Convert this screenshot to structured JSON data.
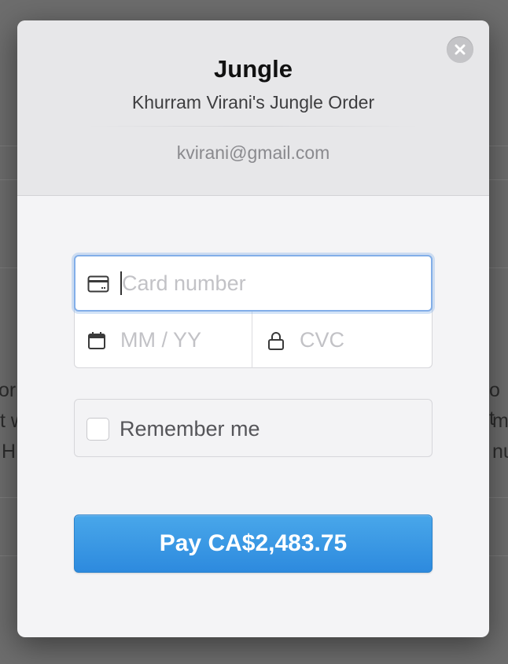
{
  "background": {
    "left_lines": [
      "oric",
      "t w",
      "H"
    ],
    "right_lines": [
      "o t",
      "mb",
      "nur"
    ]
  },
  "modal": {
    "title": "Jungle",
    "subtitle": "Khurram Virani's Jungle Order",
    "email": "kvirani@gmail.com",
    "close_icon": "close-icon"
  },
  "form": {
    "card_number_placeholder": "Card number",
    "card_number_value": "",
    "expiry_placeholder": "MM / YY",
    "expiry_value": "",
    "cvc_placeholder": "CVC",
    "cvc_value": "",
    "remember_label": "Remember me",
    "remember_checked": false,
    "pay_label": "Pay CA$2,483.75"
  },
  "icons": {
    "card": "credit-card-icon",
    "calendar": "calendar-icon",
    "lock": "lock-icon"
  },
  "colors": {
    "accent": "#3a97e4",
    "focus_border": "#82aee8",
    "header_bg": "#e7e7e9"
  }
}
